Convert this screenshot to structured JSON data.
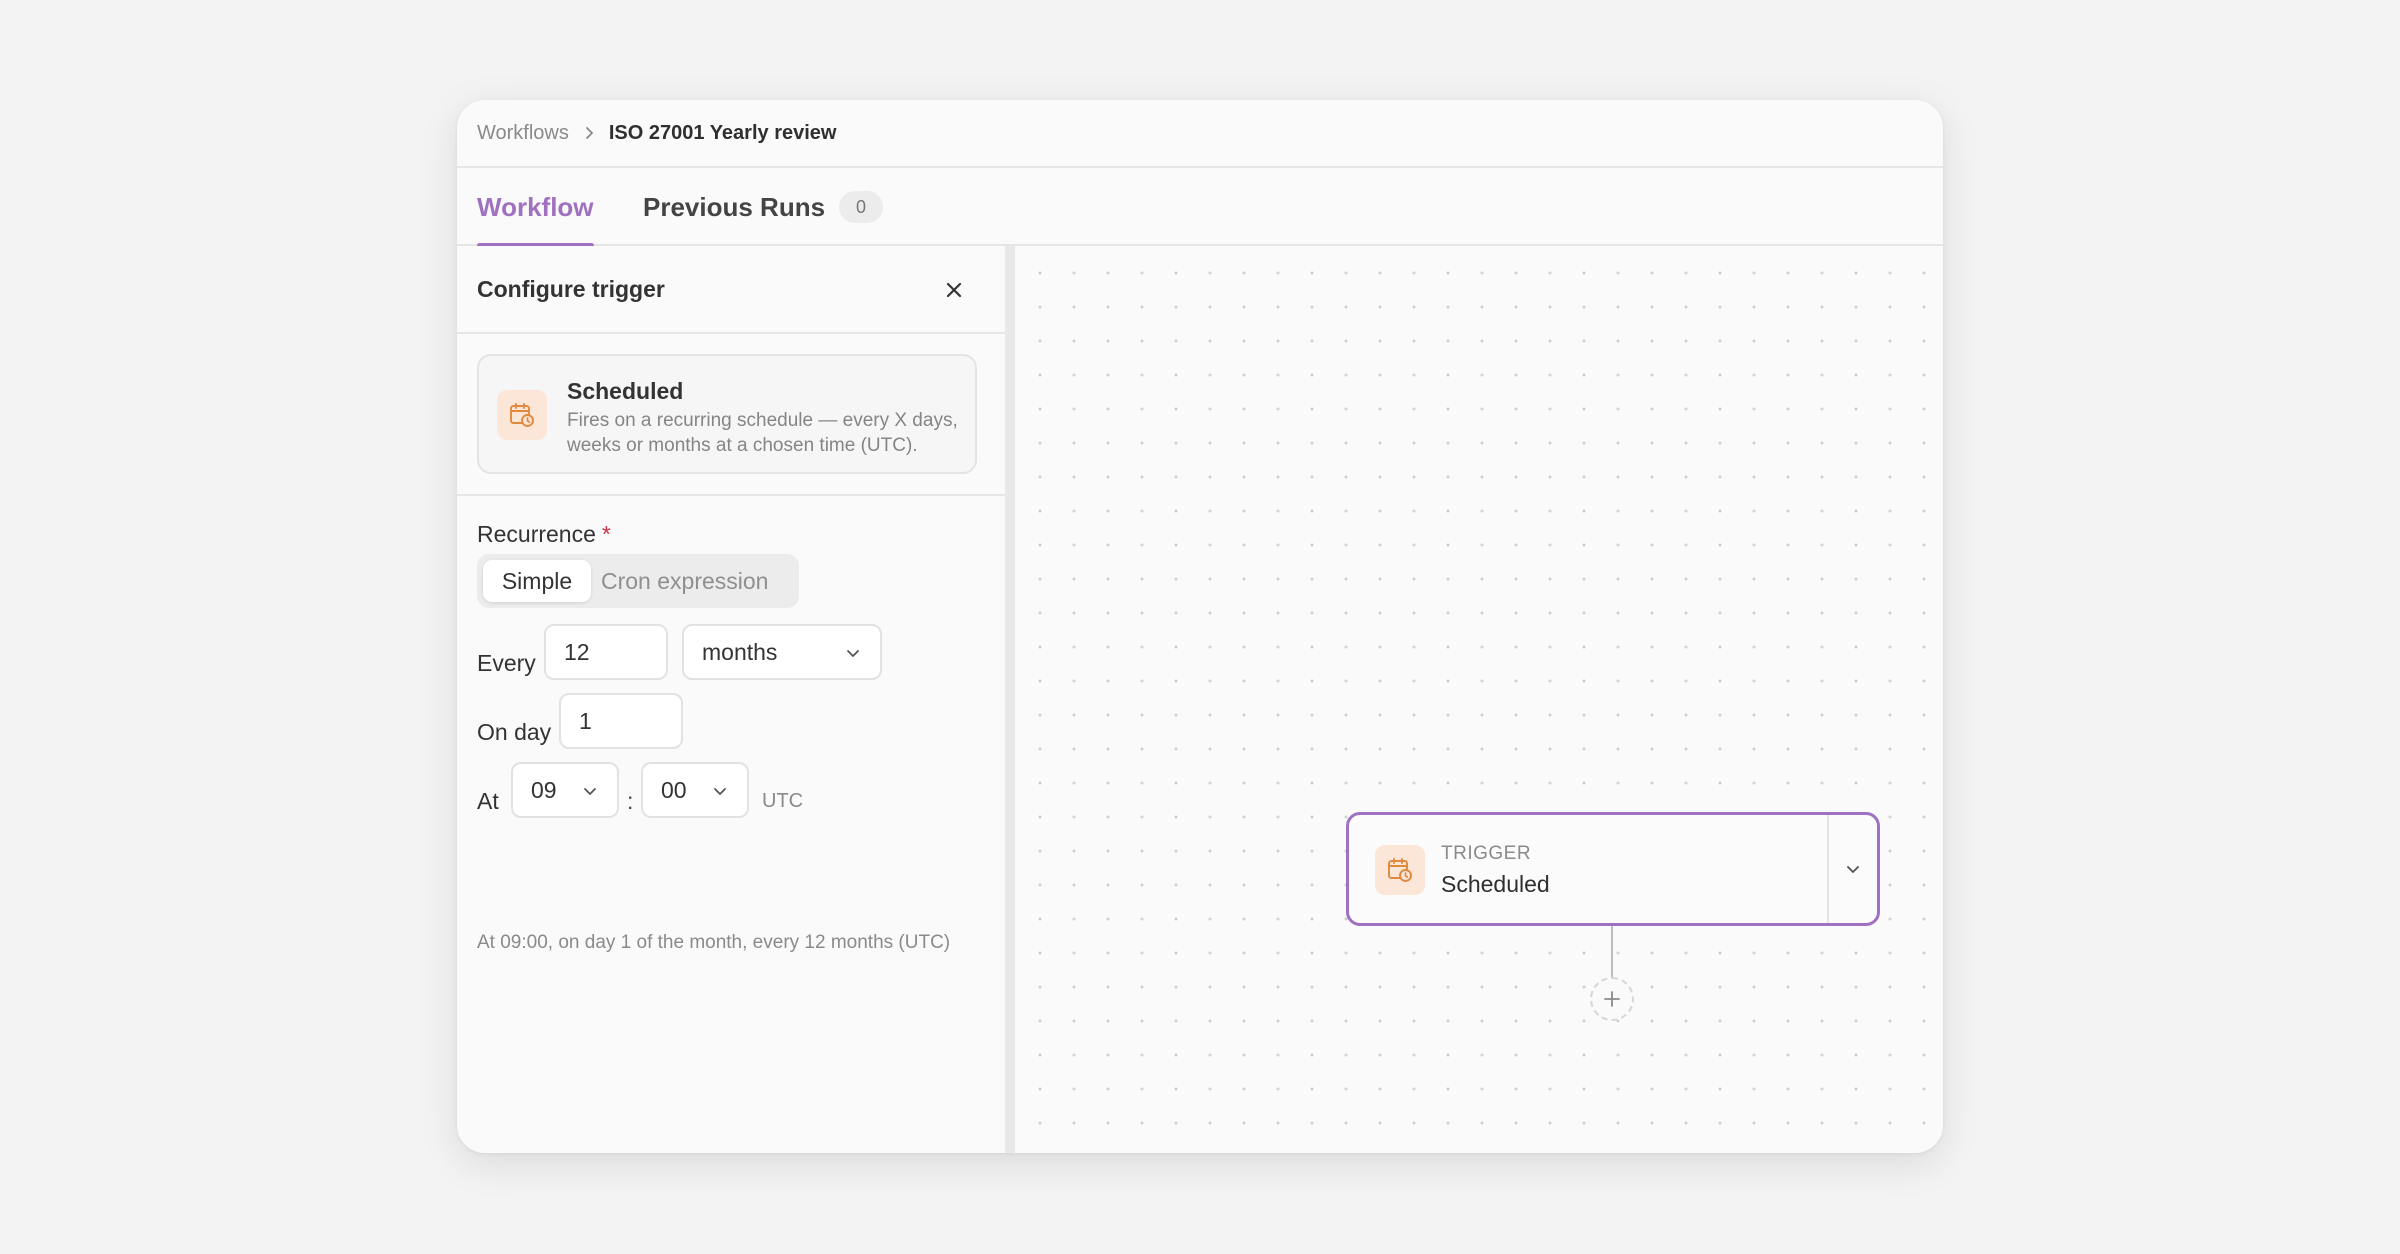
{
  "breadcrumb": {
    "root": "Workflows",
    "current": "ISO 27001 Yearly review"
  },
  "tabs": [
    {
      "label": "Workflow",
      "active": true
    },
    {
      "label": "Previous Runs",
      "badge": "0",
      "active": false
    }
  ],
  "panel": {
    "title": "Configure trigger",
    "trigger": {
      "name": "Scheduled",
      "description": "Fires on a recurring schedule — every X days, weeks or months at a chosen time (UTC).",
      "icon": "calendar-clock-icon"
    },
    "recurrence": {
      "label": "Recurrence",
      "required_mark": "*",
      "modes": [
        "Simple",
        "Cron expression"
      ],
      "selected_mode": "Simple"
    },
    "every": {
      "label": "Every",
      "value": "12",
      "unit": "months"
    },
    "on_day": {
      "label": "On day",
      "value": "1"
    },
    "at": {
      "label": "At",
      "hour": "09",
      "separator": ":",
      "minute": "00",
      "timezone": "UTC"
    },
    "summary": "At 09:00, on day 1 of the month, every 12 months (UTC)"
  },
  "canvas": {
    "node": {
      "kind": "TRIGGER",
      "name": "Scheduled",
      "icon": "calendar-clock-icon"
    },
    "add_step_icon": "plus-icon"
  },
  "colors": {
    "accent": "#a071c0",
    "icon_bg": "#fbe6d7",
    "icon_fg": "#e0893f",
    "required": "#c9304a"
  }
}
